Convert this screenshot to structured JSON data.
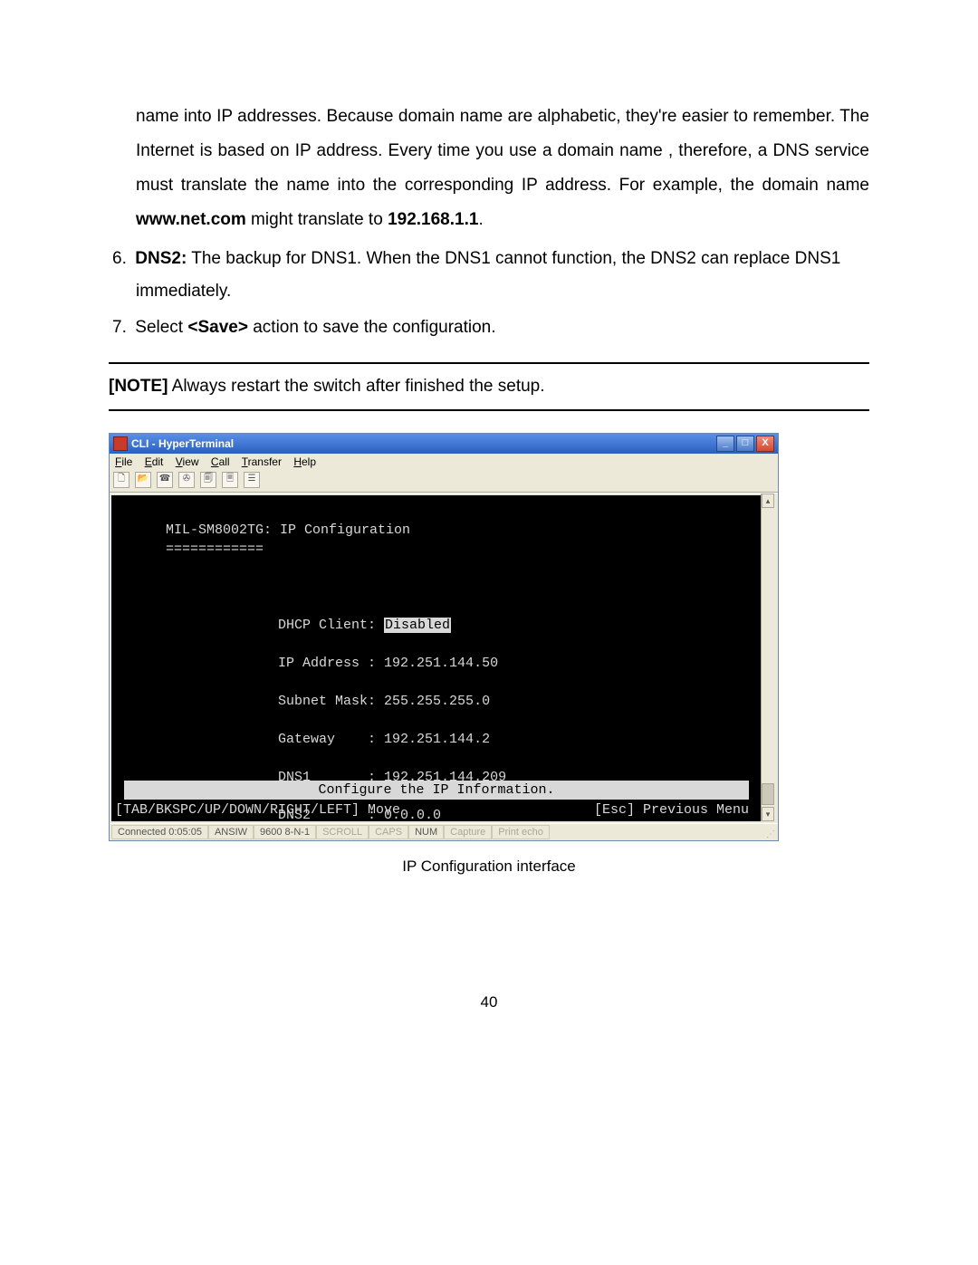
{
  "paragraph_intro": "name into IP addresses. Because domain name are alphabetic, they're easier to remember. The Internet is based on IP address. Every time you use a domain name , therefore, a DNS service must translate the name into the corresponding IP address. For example, the domain name ",
  "domain_example": "www.net.com",
  "paragraph_after_domain": " might translate to ",
  "ip_example": "192.168.1.1",
  "period": ".",
  "item6_marker": "6.",
  "item6_label": "DNS2:",
  "item6_text": " The backup for DNS1. When the DNS1 cannot function, the DNS2 can replace DNS1 immediately.",
  "item7_marker": "7.",
  "item7_pre": "  Select ",
  "item7_bold": "<Save>",
  "item7_post": " action to save the configuration.",
  "note_label": "[NOTE]",
  "note_text": " Always restart the switch after finished the setup.",
  "window": {
    "title": "CLI - HyperTerminal",
    "min": "_",
    "max": "□",
    "close": "X",
    "menus": [
      "File",
      "Edit",
      "View",
      "Call",
      "Transfer",
      "Help"
    ],
    "terminal": {
      "title": "MIL-SM8002TG: IP Configuration",
      "underline": "============",
      "rows": [
        {
          "label": "DHCP Client:",
          "value": "Disabled",
          "highlight": true
        },
        {
          "label": "IP Address :",
          "value": "192.251.144.50"
        },
        {
          "label": "Subnet Mask:",
          "value": "255.255.255.0"
        },
        {
          "label": "Gateway    :",
          "value": "192.251.144.2"
        },
        {
          "label": "DNS1       :",
          "value": "192.251.144.209"
        },
        {
          "label": "DNS2       :",
          "value": "0.0.0.0"
        }
      ],
      "invbar": "Configure the IP Information.",
      "bottom_left": "[TAB/BKSPC/UP/DOWN/RIGHT/LEFT] Move",
      "bottom_right": "[Esc] Previous Menu"
    },
    "status": {
      "c1": "Connected 0:05:05",
      "c2": "ANSIW",
      "c3": "9600 8-N-1",
      "c4": "SCROLL",
      "c5": "CAPS",
      "c6": "NUM",
      "c7": "Capture",
      "c8": "Print echo"
    }
  },
  "caption": "IP Configuration interface",
  "page_number": "40"
}
